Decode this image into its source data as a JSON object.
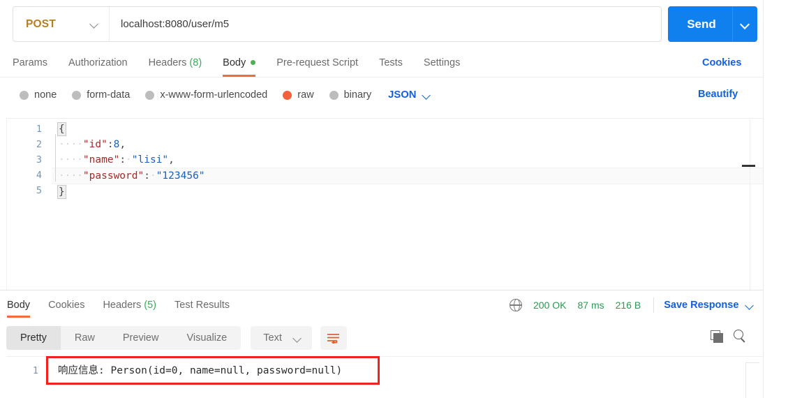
{
  "request": {
    "method": "POST",
    "url": "localhost:8080/user/m5",
    "send_label": "Send",
    "tabs": [
      {
        "label": "Params",
        "count": "",
        "active": false,
        "dot": false
      },
      {
        "label": "Authorization",
        "count": "",
        "active": false,
        "dot": false
      },
      {
        "label": "Headers",
        "count": "(8)",
        "active": false,
        "dot": false
      },
      {
        "label": "Body",
        "count": "",
        "active": true,
        "dot": true
      },
      {
        "label": "Pre-request Script",
        "count": "",
        "active": false,
        "dot": false
      },
      {
        "label": "Tests",
        "count": "",
        "active": false,
        "dot": false
      },
      {
        "label": "Settings",
        "count": "",
        "active": false,
        "dot": false
      }
    ],
    "cookies_link": "Cookies",
    "beautify_link": "Beautify",
    "body_types": [
      {
        "label": "none",
        "selected": false
      },
      {
        "label": "form-data",
        "selected": false
      },
      {
        "label": "x-www-form-urlencoded",
        "selected": false
      },
      {
        "label": "raw",
        "selected": true
      },
      {
        "label": "binary",
        "selected": false
      }
    ],
    "raw_format": "JSON",
    "body_lines": [
      "1",
      "2",
      "3",
      "4",
      "5"
    ],
    "body_code": {
      "line1_brace": "{",
      "line2_indent": "····",
      "line2_key": "\"id\"",
      "line2_colon": ":",
      "line2_value": "8",
      "line2_comma": ",",
      "line3_indent": "····",
      "line3_key": "\"name\"",
      "line3_colon": ":",
      "line3_space": "·",
      "line3_value": "\"lisi\"",
      "line3_comma": ",",
      "line4_indent": "····",
      "line4_key": "\"password\"",
      "line4_colon": ":",
      "line4_space": "·",
      "line4_value": "\"123456\"",
      "line5_brace": "}"
    }
  },
  "response": {
    "tabs": [
      {
        "label": "Body",
        "count": "",
        "active": true
      },
      {
        "label": "Cookies",
        "count": "",
        "active": false
      },
      {
        "label": "Headers",
        "count": "(5)",
        "active": false
      },
      {
        "label": "Test Results",
        "count": "",
        "active": false
      }
    ],
    "status": "200 OK",
    "time": "87 ms",
    "size": "216 B",
    "save_response_label": "Save Response",
    "view_modes": [
      {
        "label": "Pretty",
        "active": true
      },
      {
        "label": "Raw",
        "active": false
      },
      {
        "label": "Preview",
        "active": false
      },
      {
        "label": "Visualize",
        "active": false
      }
    ],
    "language": "Text",
    "line_number": "1",
    "body_text": "响应信息: Person(id=0, name=null, password=null)"
  },
  "colors": {
    "accent_orange": "#f26b3a",
    "send_blue": "#1080ef",
    "link_blue": "#1260e0",
    "method_gold": "#b58022",
    "status_green": "#2a9a52",
    "annotation_red": "#f22121",
    "json_key": "#a52a2a",
    "json_value": "#1560c4"
  }
}
